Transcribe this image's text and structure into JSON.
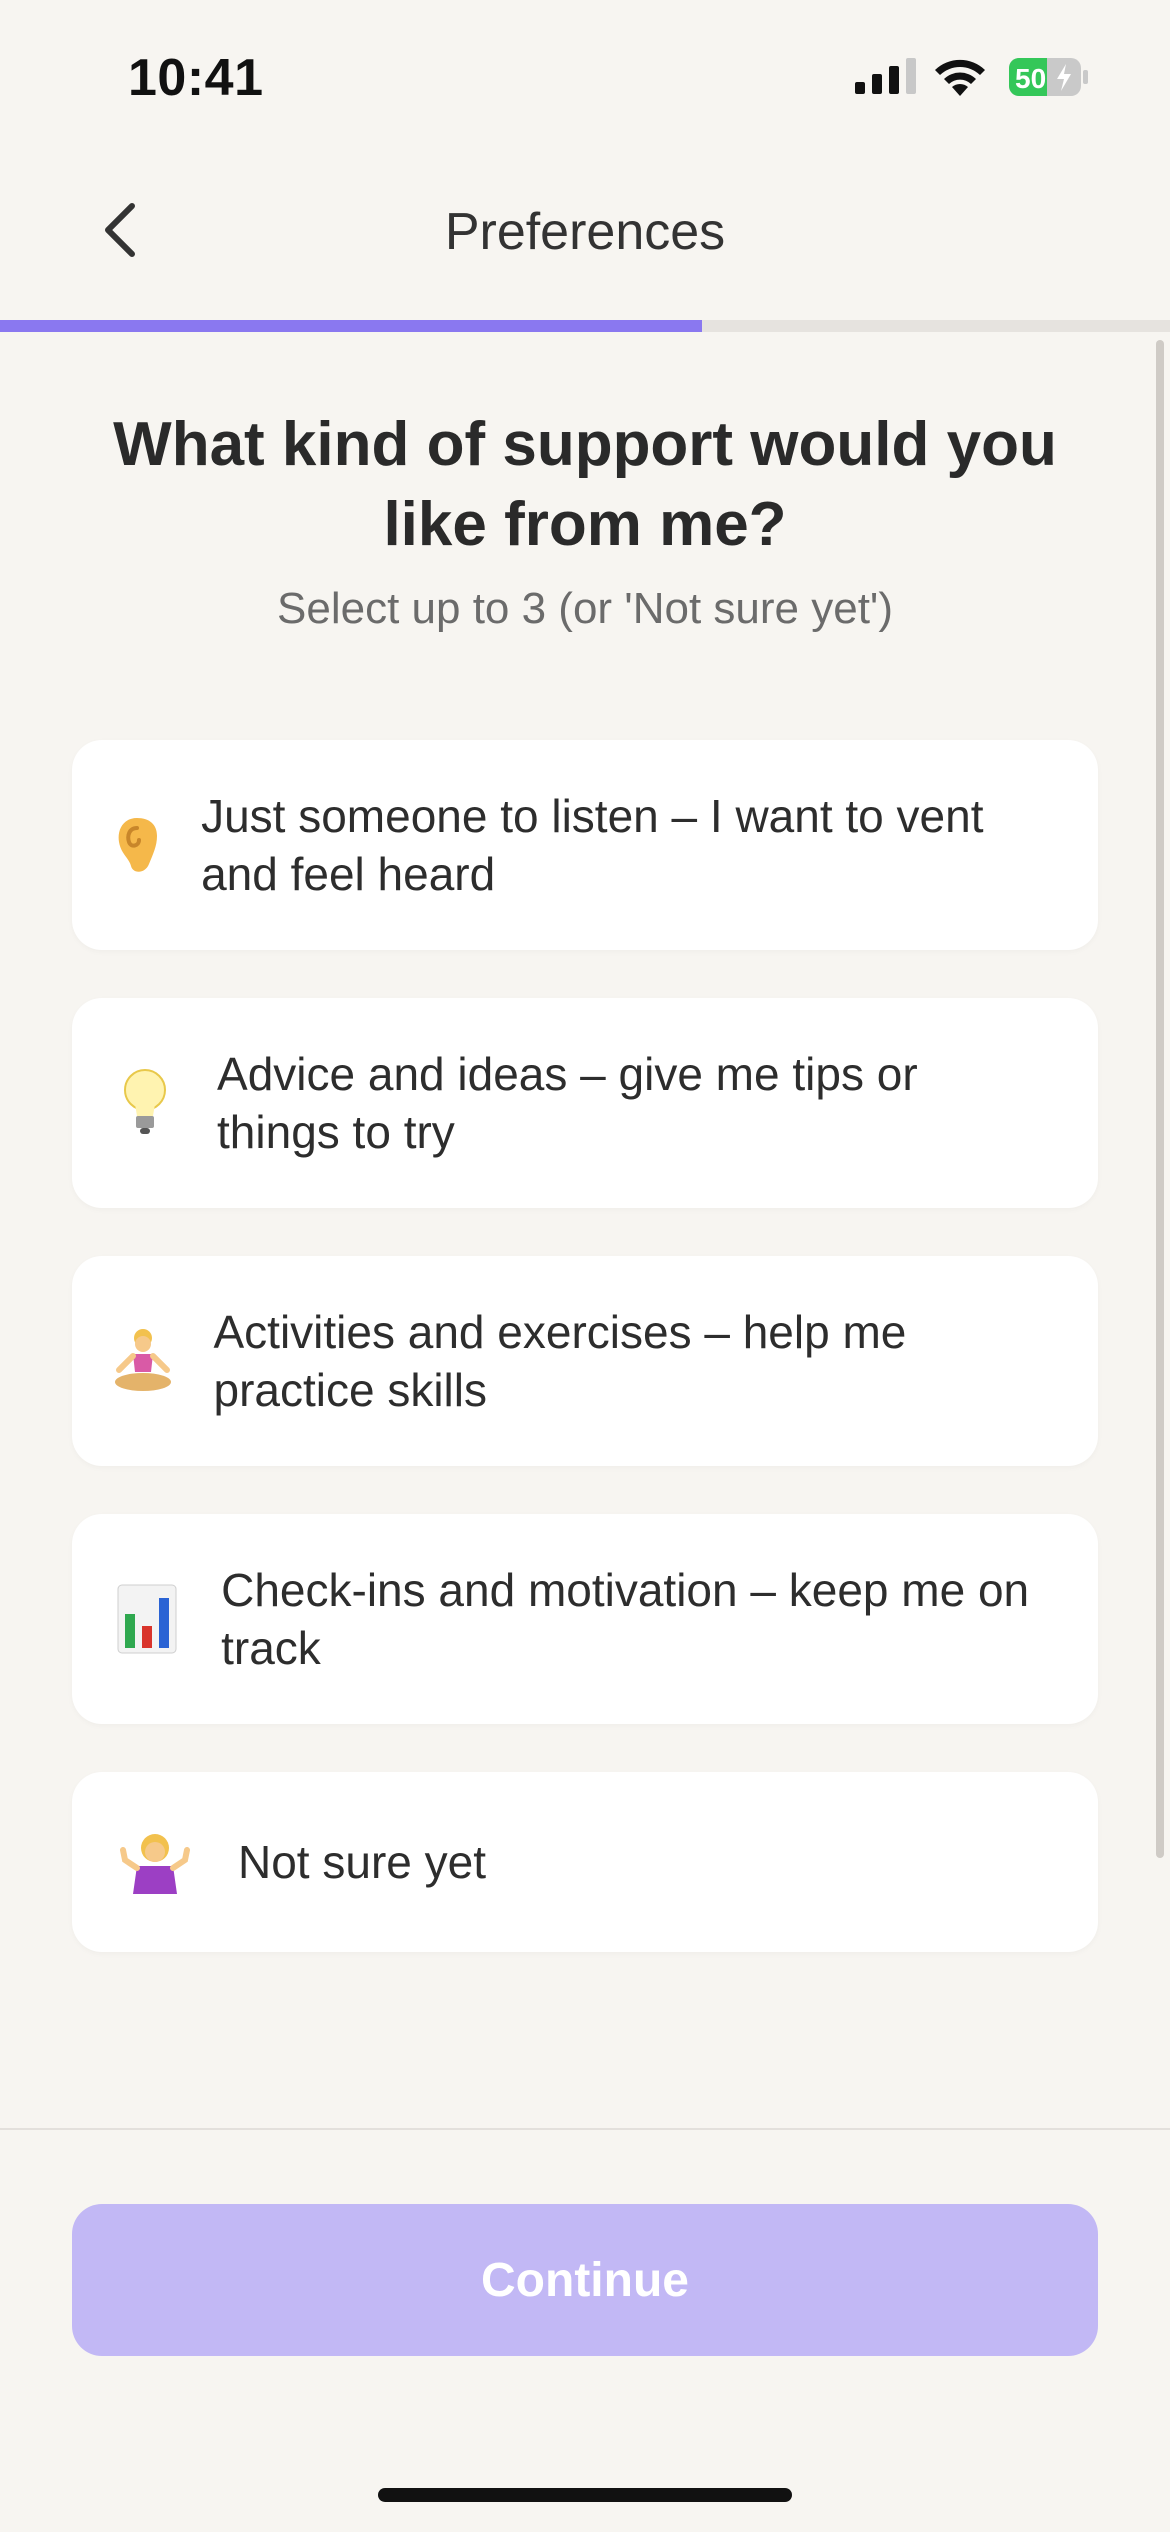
{
  "status_bar": {
    "time": "10:41",
    "battery_level": "50",
    "signal_icon": "cellular-signal-icon",
    "wifi_icon": "wifi-icon",
    "battery_icon": "battery-charging-icon"
  },
  "header": {
    "title": "Preferences",
    "back_icon": "chevron-left-icon"
  },
  "progress": {
    "value_fraction": 0.6
  },
  "question": {
    "title": "What kind of support would you like from me?",
    "subtitle": "Select up to 3 (or 'Not sure yet')"
  },
  "options": [
    {
      "icon": "ear-icon",
      "glyph": "👂",
      "label": "Just someone to listen – I want to vent and feel heard"
    },
    {
      "icon": "lightbulb-icon",
      "glyph": "💡",
      "label": "Advice and ideas – give me tips or things to try"
    },
    {
      "icon": "meditation-icon",
      "glyph": "🧘",
      "label": "Activities and exercises – help me practice skills"
    },
    {
      "icon": "bar-chart-icon",
      "glyph": "📊",
      "label": "Check-ins and motivation – keep me on track"
    },
    {
      "icon": "shrug-icon",
      "glyph": "🤷",
      "label": "Not sure yet"
    }
  ],
  "colors": {
    "accent": "#8a78f0",
    "button_disabled": "#c2b8f5",
    "background": "#f7f5f1"
  },
  "footer": {
    "continue_label": "Continue"
  }
}
